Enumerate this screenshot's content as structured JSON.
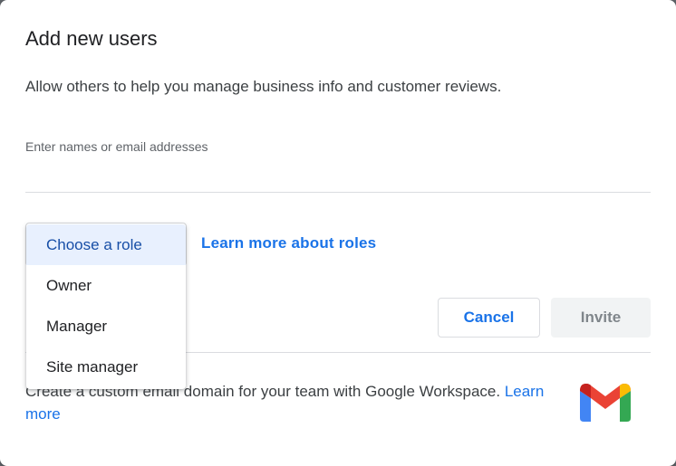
{
  "dialog": {
    "title": "Add new users",
    "subtitle": "Allow others to help you manage business info and customer reviews."
  },
  "invite_field": {
    "placeholder": "Enter names or email addresses",
    "value": ""
  },
  "roles": {
    "learn_more": "Learn more about roles",
    "menu_items": [
      "Choose a role",
      "Owner",
      "Manager",
      "Site manager"
    ],
    "selected": "Choose a role"
  },
  "actions": {
    "cancel": "Cancel",
    "invite": "Invite"
  },
  "promo": {
    "text": "Create a custom email domain for your team with Google Workspace. ",
    "link": "Learn more",
    "icon": "gmail-logo"
  },
  "colors": {
    "accent": "#1a73e8",
    "selected_bg": "#e8f0fe",
    "disabled_bg": "#f1f3f4"
  }
}
